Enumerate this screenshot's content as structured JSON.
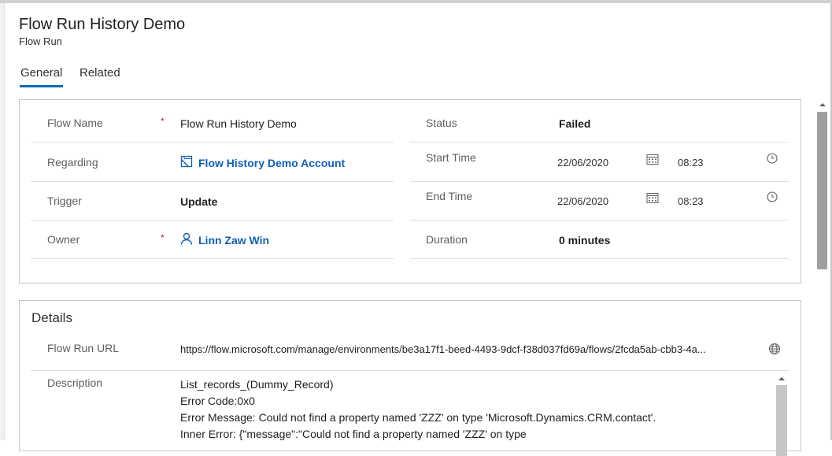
{
  "header": {
    "title": "Flow Run History Demo",
    "subtitle": "Flow Run"
  },
  "tabs": [
    {
      "label": "General",
      "selected": true
    },
    {
      "label": "Related",
      "selected": false
    }
  ],
  "general": {
    "left": [
      {
        "label": "Flow Name",
        "required": true,
        "value": "Flow Run History Demo"
      },
      {
        "label": "Regarding",
        "required": false,
        "value": "Flow History Demo Account",
        "icon": "account-record-icon"
      },
      {
        "label": "Trigger",
        "required": false,
        "value": "Update"
      },
      {
        "label": "Owner",
        "required": true,
        "value": "Linn Zaw Win",
        "icon": "person-icon"
      }
    ],
    "right": {
      "status": {
        "label": "Status",
        "value": "Failed"
      },
      "start": {
        "label": "Start Time",
        "date": "22/06/2020",
        "time": "08:23"
      },
      "end": {
        "label": "End Time",
        "date": "22/06/2020",
        "time": "08:23"
      },
      "duration": {
        "label": "Duration",
        "value": "0 minutes"
      }
    },
    "required_mark": "*"
  },
  "details": {
    "title": "Details",
    "url_label": "Flow Run URL",
    "url_value": "https://flow.microsoft.com/manage/environments/be3a17f1-beed-4493-9dcf-f38d037fd69a/flows/2fcda5ab-cbb3-4a...",
    "description_label": "Description",
    "description_lines": [
      "List_records_(Dummy_Record)",
      "Error Code:0x0",
      "Error Message: Could not find a property named 'ZZZ' on type 'Microsoft.Dynamics.CRM.contact'.",
      "Inner Error: {\"message\":\"Could not find a property named 'ZZZ' on type"
    ]
  },
  "colors": {
    "accent": "#0f6cbd",
    "link": "#1160b7",
    "required": "#a4262c"
  }
}
